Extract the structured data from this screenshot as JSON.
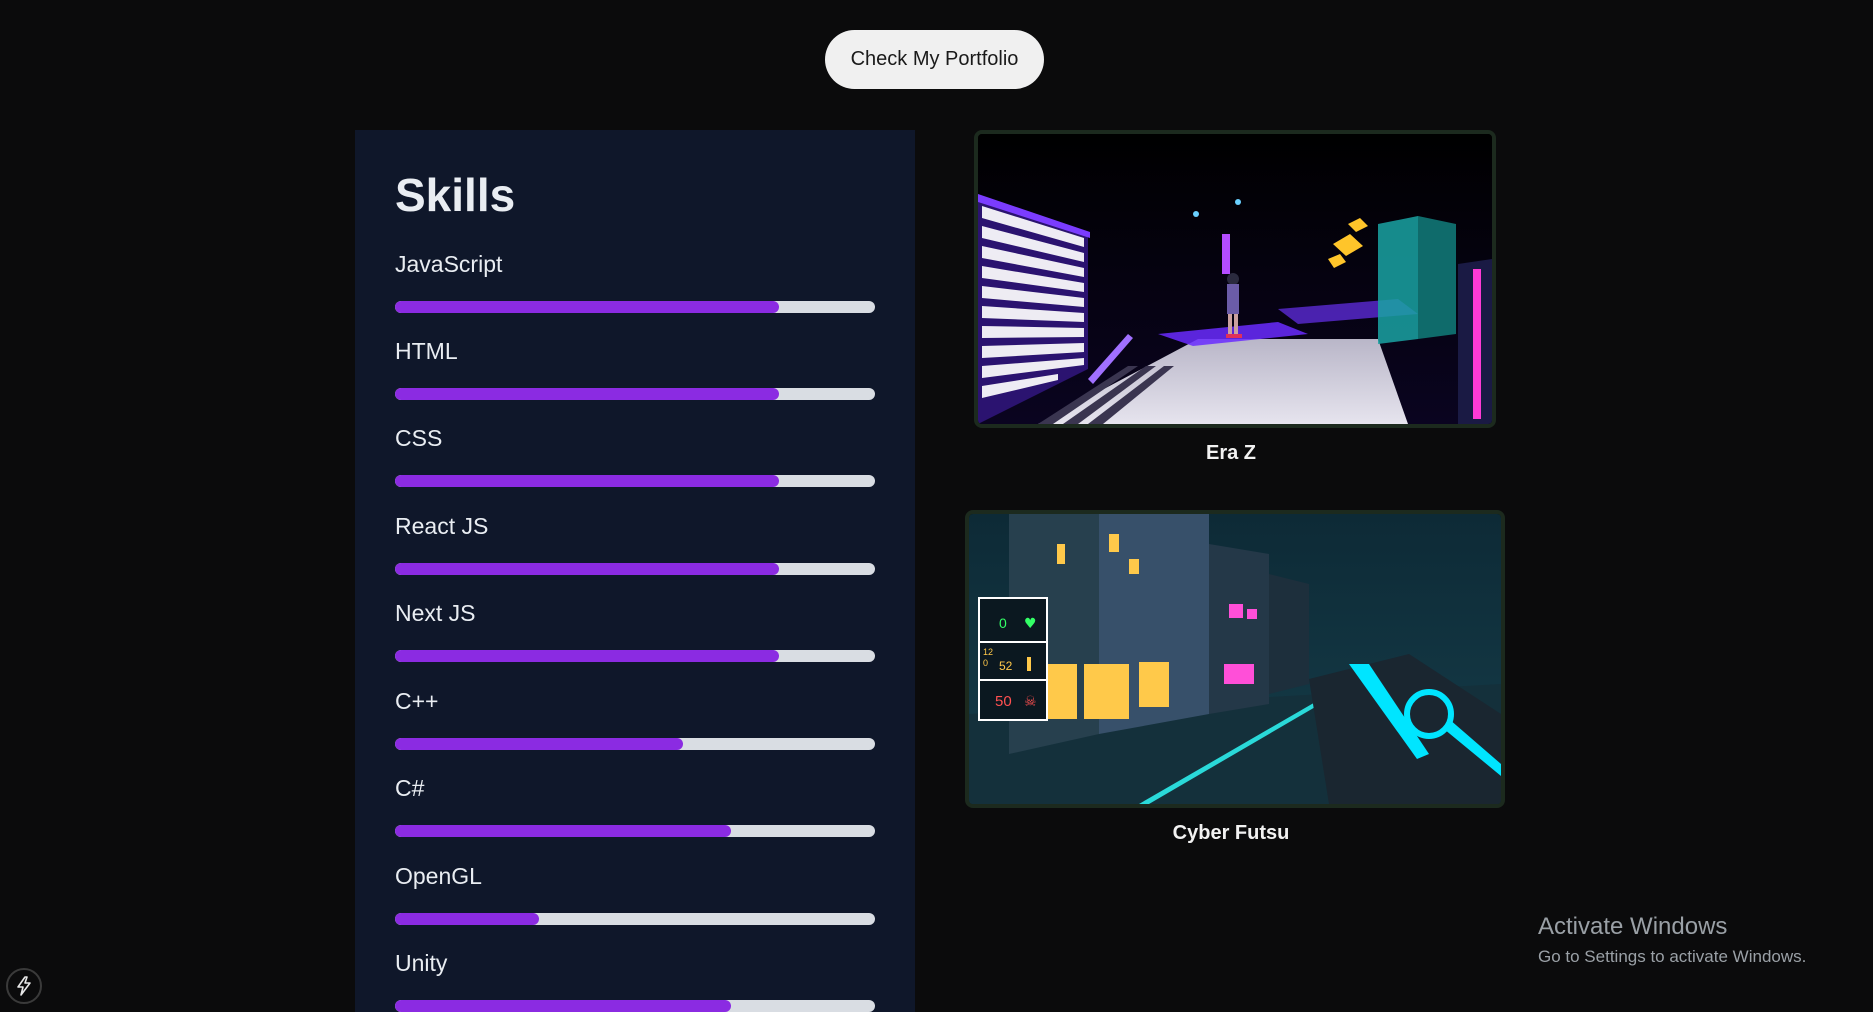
{
  "header": {
    "portfolio_button_label": "Check My Portfolio"
  },
  "skills": {
    "title": "Skills",
    "items": [
      {
        "name": "JavaScript",
        "level": 0.8
      },
      {
        "name": "HTML",
        "level": 0.8
      },
      {
        "name": "CSS",
        "level": 0.8
      },
      {
        "name": "React JS",
        "level": 0.8
      },
      {
        "name": "Next JS",
        "level": 0.8
      },
      {
        "name": "C++",
        "level": 0.6
      },
      {
        "name": "C#",
        "level": 0.7
      },
      {
        "name": "OpenGL",
        "level": 0.3
      },
      {
        "name": "Unity",
        "level": 0.7
      }
    ],
    "bar_color": "#8b2be2",
    "track_color": "#d9dde3"
  },
  "projects": [
    {
      "title": "Era Z",
      "thumbnail": "neon-city-runner-screenshot"
    },
    {
      "title": "Cyber Futsu",
      "thumbnail": "cyberpunk-fps-screenshot"
    }
  ],
  "hud": {
    "health": "0",
    "ammo_top": "12",
    "ammo_bottom": "0",
    "ammo_reserve": "52",
    "kills": "50"
  },
  "watermark": {
    "title": "Activate Windows",
    "subtitle": "Go to Settings to activate Windows."
  },
  "dev_badge_icon": "lightning-icon"
}
